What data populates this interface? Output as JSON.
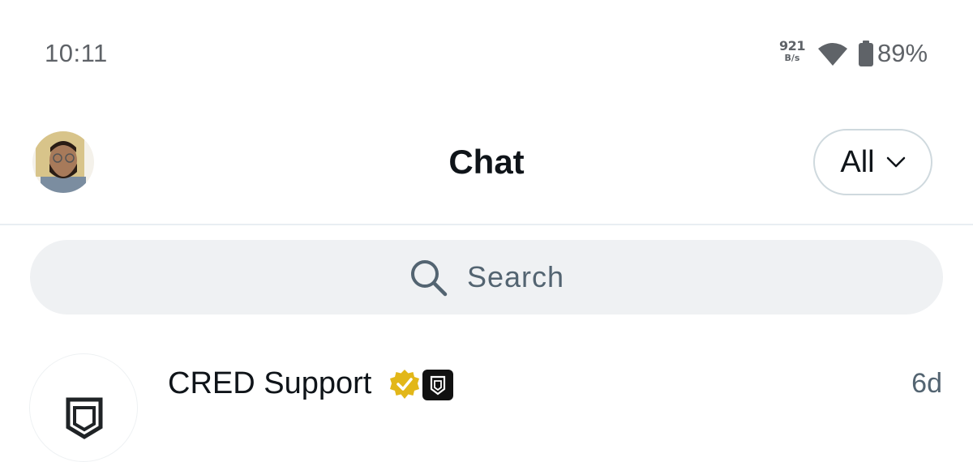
{
  "status_bar": {
    "time": "10:11",
    "net_speed_value": "921",
    "net_speed_unit": "B/s",
    "battery_percent": "89%",
    "icons": [
      "wifi-icon",
      "battery-icon"
    ]
  },
  "header": {
    "title": "Chat",
    "filter_label": "All",
    "filter_icon": "chevron-down-icon"
  },
  "search": {
    "placeholder": "Search",
    "icon": "search-icon"
  },
  "conversations": [
    {
      "name": "CRED Support",
      "verified": true,
      "badge_icon": "cred-logo-icon",
      "time": "6d"
    }
  ],
  "colors": {
    "text_primary": "#0f1419",
    "text_secondary": "#536471",
    "search_bg": "#eff1f3",
    "divider": "#e8eef2",
    "verified_gold": "#e2b719"
  }
}
